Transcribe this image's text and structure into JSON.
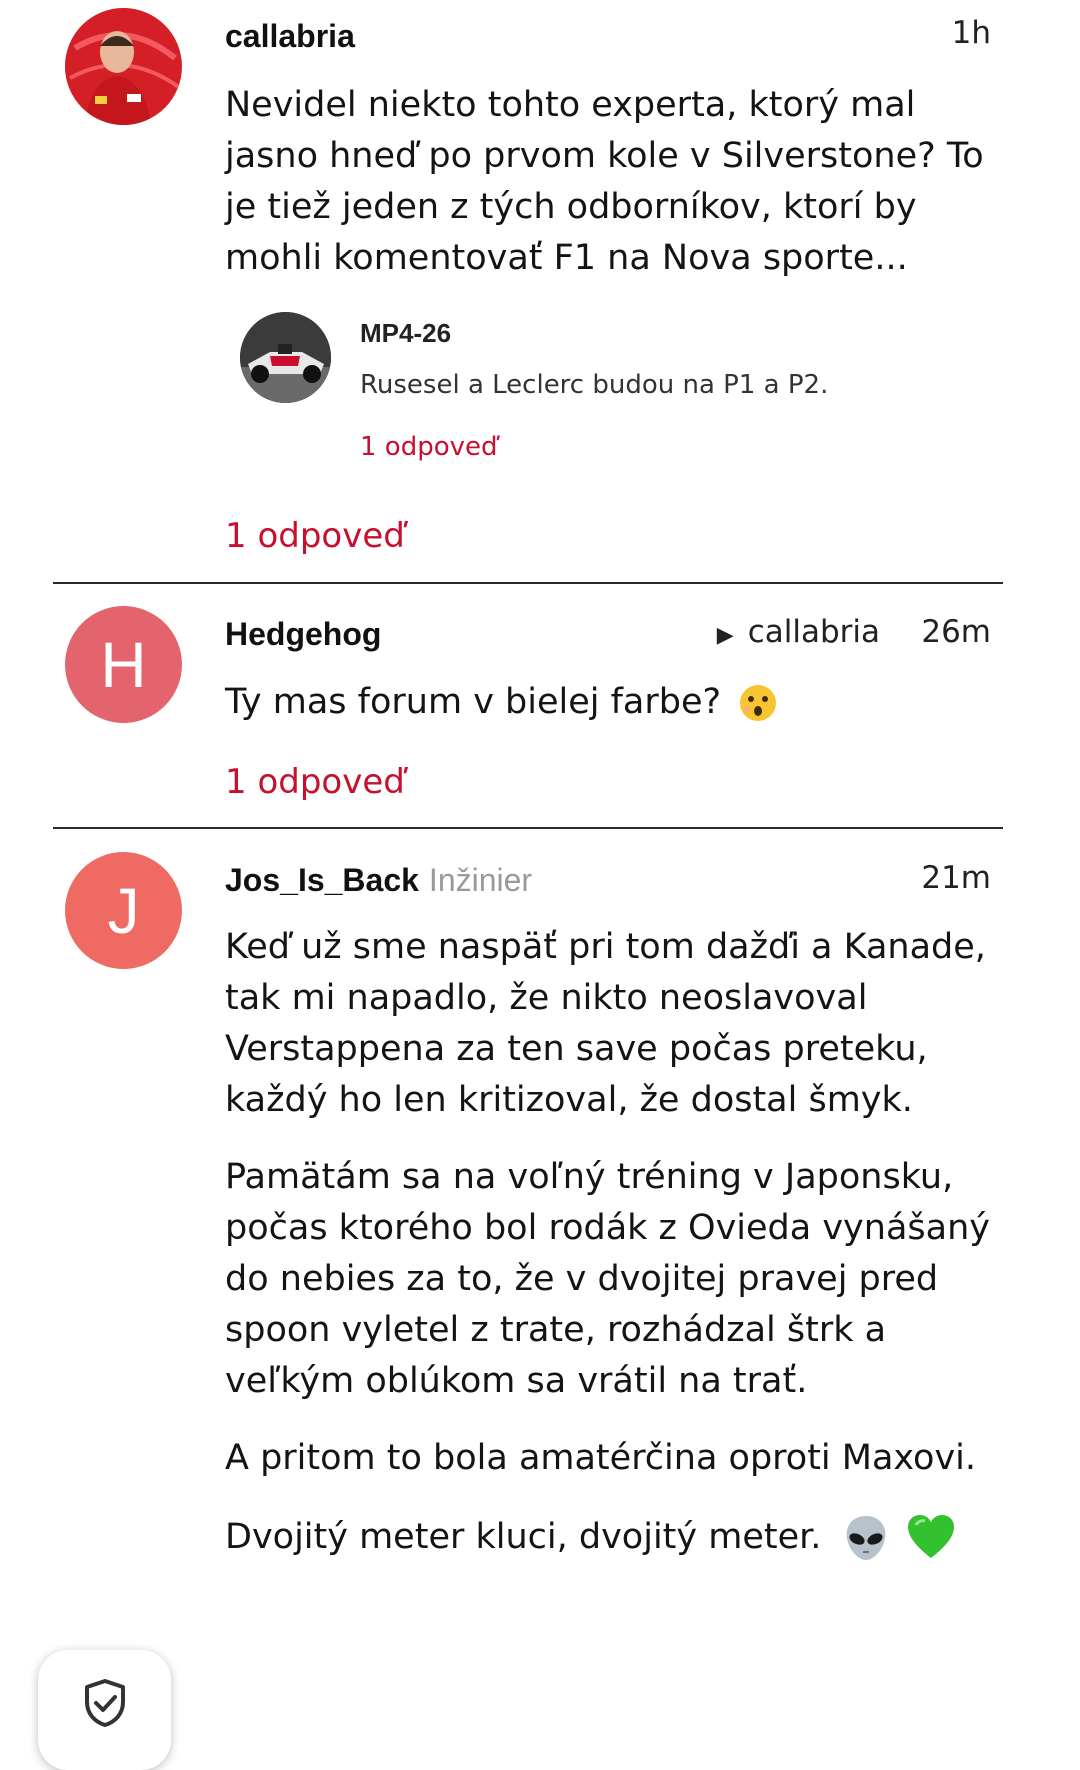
{
  "posts": [
    {
      "author": "callabria",
      "time": "1h",
      "avatar_icon": "racing-driver-photo",
      "body": [
        "Nevidel niekto tohto experta, ktorý mal jasno hneď po prvom kole v Silverstone? To je tiež jeden z tých odborníkov, ktorí by mohli komentovať F1 na Nova sporte..."
      ],
      "quote": {
        "author": "MP4-26",
        "avatar_icon": "race-car-photo",
        "text": "Rusesel a Leclerc budou na P1 a P2.",
        "replies": "1 odpoveď"
      },
      "replies": "1 odpoveď"
    },
    {
      "author": "Hedgehog",
      "avatar_letter": "H",
      "avatar_color": "#e4646e",
      "reply_to": "callabria",
      "reply_to_icon": "play-triangle-icon",
      "time": "26m",
      "body": [
        "Ty mas forum v bielej farbe?"
      ],
      "emoji": "surprised-face-emoji",
      "replies": "1 odpoveď"
    },
    {
      "author": "Jos_Is_Back",
      "role": "Inžinier",
      "avatar_letter": "J",
      "avatar_color": "#ee6a63",
      "time": "21m",
      "body": [
        "Keď už sme naspäť pri tom dažďi a Kanade, tak mi napadlo, že nikto neoslavoval Verstappena za ten save počas preteku, každý ho len kritizoval, že dostal šmyk.",
        "Pamätám sa na voľný tréning v Japonsku, počas ktorého bol rodák z Ovieda vynášaný do nebies za to, že v dvojitej pravej pred spoon vyletel z trate, rozhádzal štrk a veľkým oblúkom sa vrátil na trať.",
        "A pritom to bola amatérčina oproti Maxovi.",
        "Dvojitý meter kluci, dvojitý meter."
      ],
      "emojis": [
        "alien-emoji",
        "green-heart-emoji"
      ]
    }
  ],
  "floating_button_icon": "shield-check-icon",
  "colors": {
    "accent": "#c8102e",
    "divider": "#2a2a2a"
  }
}
